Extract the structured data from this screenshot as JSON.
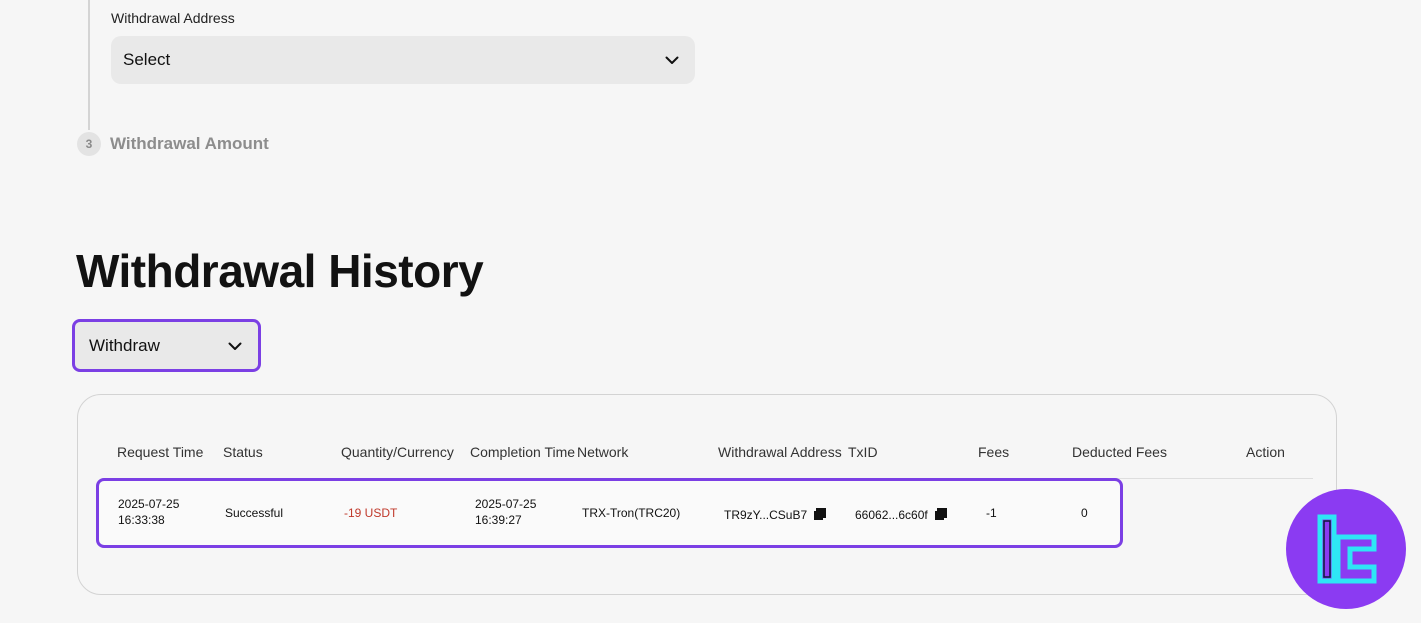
{
  "form": {
    "withdrawal_address_label": "Withdrawal Address",
    "withdrawal_address_value": "Select",
    "step3_number": "3",
    "step3_title": "Withdrawal Amount"
  },
  "history": {
    "title": "Withdrawal History",
    "type_filter": "Withdraw",
    "columns": {
      "request_time": "Request Time",
      "status": "Status",
      "quantity": "Quantity/Currency",
      "completion_time": "Completion Time",
      "network": "Network",
      "address": "Withdrawal Address",
      "txid": "TxID",
      "fees": "Fees",
      "deducted_fees": "Deducted Fees",
      "action": "Action"
    },
    "rows": [
      {
        "request_date": "2025-07-25",
        "request_clock": "16:33:38",
        "status": "Successful",
        "quantity": "-19 USDT",
        "completion_date": "2025-07-25",
        "completion_clock": "16:39:27",
        "network": "TRX-Tron(TRC20)",
        "address": "TR9zY...CSuB7",
        "txid": "66062...6c60f",
        "fees": "-1",
        "deducted_fees": "0"
      }
    ]
  },
  "colors": {
    "accent_highlight": "#7b3fe4",
    "negative_amount": "#c0392b",
    "badge_bg": "#8b3bf2",
    "badge_logo": "#2ee6f5"
  },
  "icons": {
    "dropdown": "chevron-down-icon",
    "copy": "copy-icon",
    "badge": "brand-logo-icon"
  }
}
